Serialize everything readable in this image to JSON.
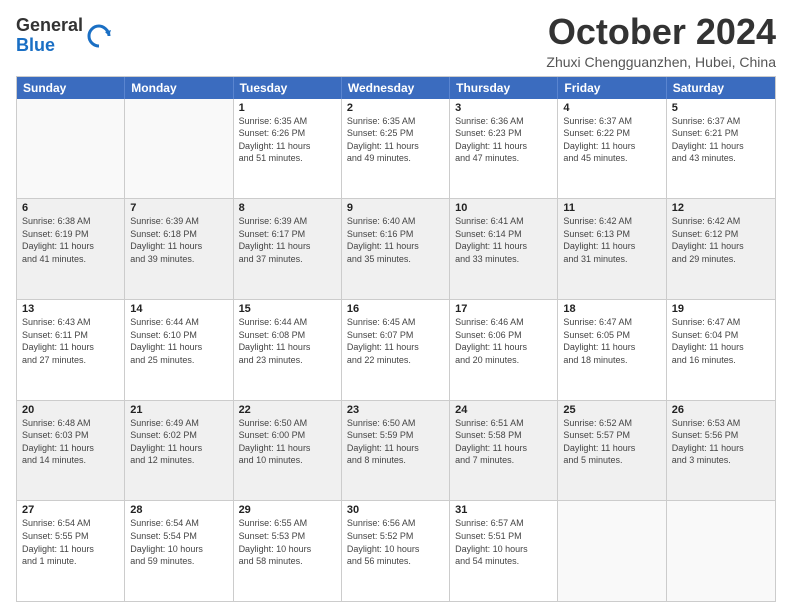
{
  "logo": {
    "general": "General",
    "blue": "Blue"
  },
  "title": "October 2024",
  "subtitle": "Zhuxi Chengguanzhen, Hubei, China",
  "headers": [
    "Sunday",
    "Monday",
    "Tuesday",
    "Wednesday",
    "Thursday",
    "Friday",
    "Saturday"
  ],
  "weeks": [
    [
      {
        "day": "",
        "lines": [],
        "empty": true
      },
      {
        "day": "",
        "lines": [],
        "empty": true
      },
      {
        "day": "1",
        "lines": [
          "Sunrise: 6:35 AM",
          "Sunset: 6:26 PM",
          "Daylight: 11 hours",
          "and 51 minutes."
        ]
      },
      {
        "day": "2",
        "lines": [
          "Sunrise: 6:35 AM",
          "Sunset: 6:25 PM",
          "Daylight: 11 hours",
          "and 49 minutes."
        ]
      },
      {
        "day": "3",
        "lines": [
          "Sunrise: 6:36 AM",
          "Sunset: 6:23 PM",
          "Daylight: 11 hours",
          "and 47 minutes."
        ]
      },
      {
        "day": "4",
        "lines": [
          "Sunrise: 6:37 AM",
          "Sunset: 6:22 PM",
          "Daylight: 11 hours",
          "and 45 minutes."
        ]
      },
      {
        "day": "5",
        "lines": [
          "Sunrise: 6:37 AM",
          "Sunset: 6:21 PM",
          "Daylight: 11 hours",
          "and 43 minutes."
        ]
      }
    ],
    [
      {
        "day": "6",
        "lines": [
          "Sunrise: 6:38 AM",
          "Sunset: 6:19 PM",
          "Daylight: 11 hours",
          "and 41 minutes."
        ]
      },
      {
        "day": "7",
        "lines": [
          "Sunrise: 6:39 AM",
          "Sunset: 6:18 PM",
          "Daylight: 11 hours",
          "and 39 minutes."
        ]
      },
      {
        "day": "8",
        "lines": [
          "Sunrise: 6:39 AM",
          "Sunset: 6:17 PM",
          "Daylight: 11 hours",
          "and 37 minutes."
        ]
      },
      {
        "day": "9",
        "lines": [
          "Sunrise: 6:40 AM",
          "Sunset: 6:16 PM",
          "Daylight: 11 hours",
          "and 35 minutes."
        ]
      },
      {
        "day": "10",
        "lines": [
          "Sunrise: 6:41 AM",
          "Sunset: 6:14 PM",
          "Daylight: 11 hours",
          "and 33 minutes."
        ]
      },
      {
        "day": "11",
        "lines": [
          "Sunrise: 6:42 AM",
          "Sunset: 6:13 PM",
          "Daylight: 11 hours",
          "and 31 minutes."
        ]
      },
      {
        "day": "12",
        "lines": [
          "Sunrise: 6:42 AM",
          "Sunset: 6:12 PM",
          "Daylight: 11 hours",
          "and 29 minutes."
        ]
      }
    ],
    [
      {
        "day": "13",
        "lines": [
          "Sunrise: 6:43 AM",
          "Sunset: 6:11 PM",
          "Daylight: 11 hours",
          "and 27 minutes."
        ]
      },
      {
        "day": "14",
        "lines": [
          "Sunrise: 6:44 AM",
          "Sunset: 6:10 PM",
          "Daylight: 11 hours",
          "and 25 minutes."
        ]
      },
      {
        "day": "15",
        "lines": [
          "Sunrise: 6:44 AM",
          "Sunset: 6:08 PM",
          "Daylight: 11 hours",
          "and 23 minutes."
        ]
      },
      {
        "day": "16",
        "lines": [
          "Sunrise: 6:45 AM",
          "Sunset: 6:07 PM",
          "Daylight: 11 hours",
          "and 22 minutes."
        ]
      },
      {
        "day": "17",
        "lines": [
          "Sunrise: 6:46 AM",
          "Sunset: 6:06 PM",
          "Daylight: 11 hours",
          "and 20 minutes."
        ]
      },
      {
        "day": "18",
        "lines": [
          "Sunrise: 6:47 AM",
          "Sunset: 6:05 PM",
          "Daylight: 11 hours",
          "and 18 minutes."
        ]
      },
      {
        "day": "19",
        "lines": [
          "Sunrise: 6:47 AM",
          "Sunset: 6:04 PM",
          "Daylight: 11 hours",
          "and 16 minutes."
        ]
      }
    ],
    [
      {
        "day": "20",
        "lines": [
          "Sunrise: 6:48 AM",
          "Sunset: 6:03 PM",
          "Daylight: 11 hours",
          "and 14 minutes."
        ]
      },
      {
        "day": "21",
        "lines": [
          "Sunrise: 6:49 AM",
          "Sunset: 6:02 PM",
          "Daylight: 11 hours",
          "and 12 minutes."
        ]
      },
      {
        "day": "22",
        "lines": [
          "Sunrise: 6:50 AM",
          "Sunset: 6:00 PM",
          "Daylight: 11 hours",
          "and 10 minutes."
        ]
      },
      {
        "day": "23",
        "lines": [
          "Sunrise: 6:50 AM",
          "Sunset: 5:59 PM",
          "Daylight: 11 hours",
          "and 8 minutes."
        ]
      },
      {
        "day": "24",
        "lines": [
          "Sunrise: 6:51 AM",
          "Sunset: 5:58 PM",
          "Daylight: 11 hours",
          "and 7 minutes."
        ]
      },
      {
        "day": "25",
        "lines": [
          "Sunrise: 6:52 AM",
          "Sunset: 5:57 PM",
          "Daylight: 11 hours",
          "and 5 minutes."
        ]
      },
      {
        "day": "26",
        "lines": [
          "Sunrise: 6:53 AM",
          "Sunset: 5:56 PM",
          "Daylight: 11 hours",
          "and 3 minutes."
        ]
      }
    ],
    [
      {
        "day": "27",
        "lines": [
          "Sunrise: 6:54 AM",
          "Sunset: 5:55 PM",
          "Daylight: 11 hours",
          "and 1 minute."
        ]
      },
      {
        "day": "28",
        "lines": [
          "Sunrise: 6:54 AM",
          "Sunset: 5:54 PM",
          "Daylight: 10 hours",
          "and 59 minutes."
        ]
      },
      {
        "day": "29",
        "lines": [
          "Sunrise: 6:55 AM",
          "Sunset: 5:53 PM",
          "Daylight: 10 hours",
          "and 58 minutes."
        ]
      },
      {
        "day": "30",
        "lines": [
          "Sunrise: 6:56 AM",
          "Sunset: 5:52 PM",
          "Daylight: 10 hours",
          "and 56 minutes."
        ]
      },
      {
        "day": "31",
        "lines": [
          "Sunrise: 6:57 AM",
          "Sunset: 5:51 PM",
          "Daylight: 10 hours",
          "and 54 minutes."
        ]
      },
      {
        "day": "",
        "lines": [],
        "empty": true
      },
      {
        "day": "",
        "lines": [],
        "empty": true
      }
    ]
  ]
}
